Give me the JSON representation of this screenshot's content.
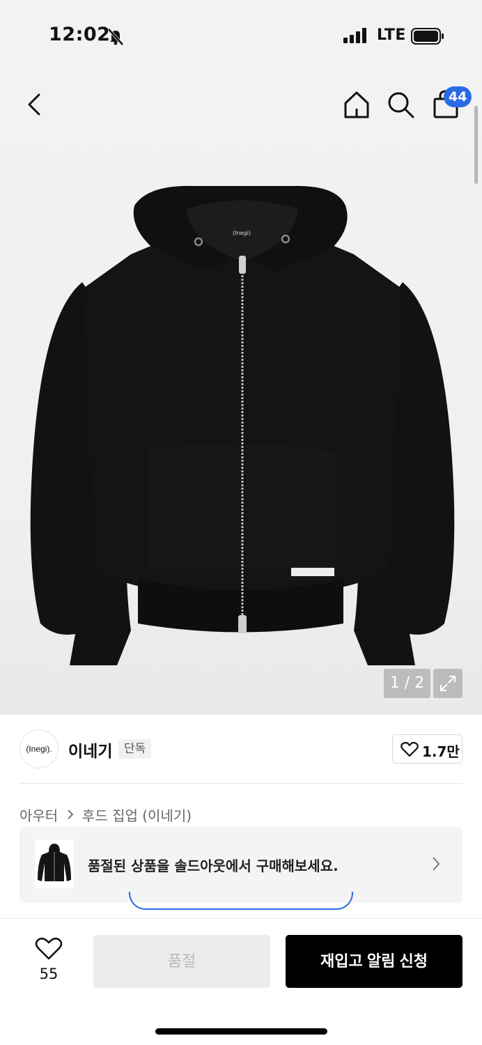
{
  "status_bar": {
    "time": "12:02",
    "network": "LTE"
  },
  "nav": {
    "cart_count": "44"
  },
  "gallery": {
    "counter": "1 / 2",
    "hoodie_brand_label": "(Inegi)"
  },
  "brand": {
    "logo_text": "(Inegi).",
    "name": "이네기",
    "badge": "단독",
    "likes": "1.7만"
  },
  "breadcrumb": {
    "items": [
      "아우터",
      "후드 집업 (이네기)"
    ],
    "separator": ">"
  },
  "soldout_banner": {
    "text": "품절된 상품을 솔드아웃에서 구매해보세요."
  },
  "bottom_bar": {
    "wish_count": "55",
    "soldout_label": "품절",
    "restock_label": "재입고 알림 신청"
  },
  "colors": {
    "accent": "#2b6ae6",
    "primary_button": "#000000",
    "disabled_button": "#ececec"
  }
}
